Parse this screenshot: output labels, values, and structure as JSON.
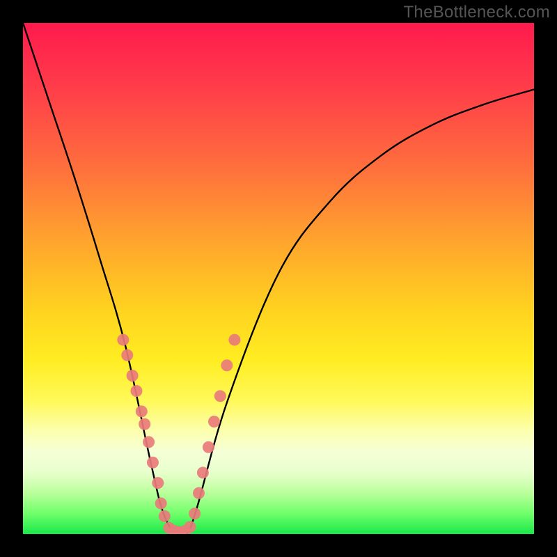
{
  "watermark": "TheBottleneck.com",
  "gradient": {
    "top": "#ff1a4d",
    "mid": "#ffd21f",
    "bottom": "#19e84a"
  },
  "chart_data": {
    "type": "line",
    "title": "",
    "xlabel": "",
    "ylabel": "",
    "xlim": [
      0,
      100
    ],
    "ylim": [
      0,
      100
    ],
    "annotations": [],
    "series": [
      {
        "name": "bottleneck-curve",
        "x": [
          0,
          5,
          10,
          15,
          20,
          25,
          27.5,
          30,
          32,
          34,
          40,
          50,
          60,
          70,
          80,
          90,
          100
        ],
        "y": [
          100,
          85,
          70,
          54,
          37,
          14,
          4,
          0,
          0,
          5,
          26,
          51,
          65,
          74,
          80,
          84,
          87
        ]
      }
    ],
    "markers": [
      {
        "series": "left-branch-dots",
        "color": "#e97b7b",
        "points_xy": [
          [
            19.6,
            38
          ],
          [
            20.4,
            35
          ],
          [
            21.4,
            31
          ],
          [
            22.2,
            28
          ],
          [
            23.2,
            24
          ],
          [
            23.8,
            21.5
          ],
          [
            24.6,
            18
          ],
          [
            25.4,
            14
          ],
          [
            26.4,
            10
          ],
          [
            27.0,
            6
          ],
          [
            27.7,
            3.5
          ]
        ]
      },
      {
        "series": "bottom-dots",
        "color": "#e97b7b",
        "points_xy": [
          [
            28.6,
            1.2
          ],
          [
            29.6,
            0.6
          ],
          [
            30.6,
            0.4
          ],
          [
            31.7,
            0.6
          ],
          [
            32.7,
            1.4
          ]
        ]
      },
      {
        "series": "right-branch-dots",
        "color": "#e97b7b",
        "points_xy": [
          [
            33.6,
            4
          ],
          [
            34.4,
            8
          ],
          [
            35.2,
            12
          ],
          [
            36.3,
            17
          ],
          [
            37.4,
            22
          ],
          [
            38.6,
            27
          ],
          [
            39.9,
            33
          ],
          [
            41.4,
            38
          ]
        ]
      }
    ]
  }
}
